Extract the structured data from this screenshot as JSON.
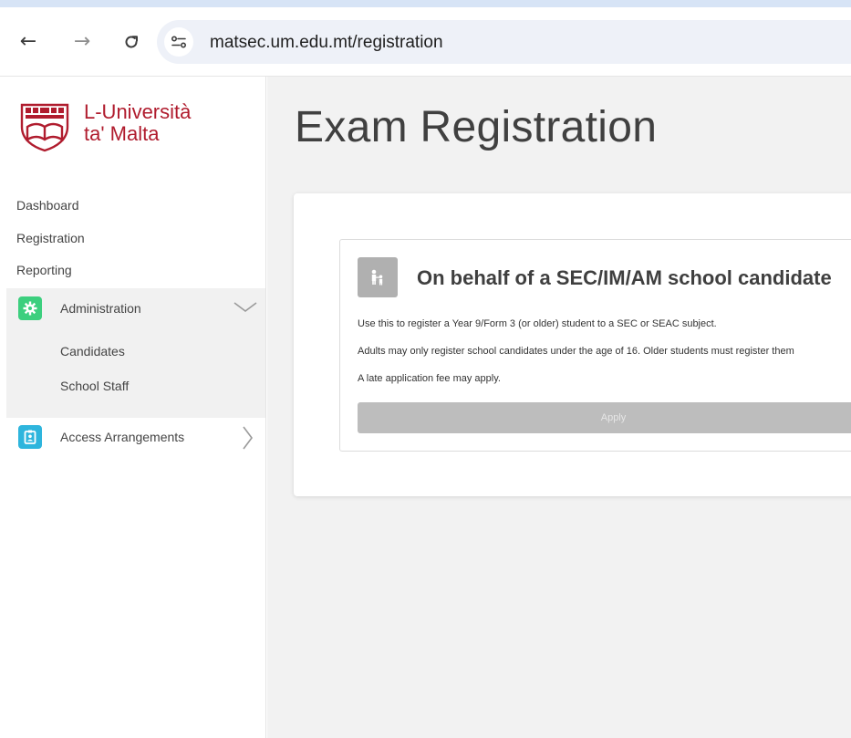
{
  "browser": {
    "url": "matsec.um.edu.mt/registration"
  },
  "brand": {
    "name_line1": "L-Università",
    "name_line2": "ta' Malta",
    "color": "#b01c2e"
  },
  "sidebar": {
    "links": [
      {
        "label": "Dashboard"
      },
      {
        "label": "Registration"
      },
      {
        "label": "Reporting"
      }
    ],
    "administration": {
      "label": "Administration",
      "icon": "gear-icon",
      "icon_color": "#3ccf7e",
      "expanded": true,
      "children": [
        {
          "label": "Candidates"
        },
        {
          "label": "School Staff"
        }
      ]
    },
    "access": {
      "label": "Access Arrangements",
      "icon": "id-badge-icon",
      "icon_color": "#2eb5dd",
      "expanded": false
    }
  },
  "main": {
    "title": "Exam Registration",
    "card": {
      "icon": "parent-child-icon",
      "title": "On behalf of a SEC/IM/AM school candidate",
      "lines": [
        "Use this to register a Year 9/Form 3 (or older) student to a SEC or SEAC subject.",
        "Adults may only register school candidates under the age of 16. Older students must register them",
        "A late application fee may apply."
      ],
      "button_label": "Apply"
    }
  }
}
